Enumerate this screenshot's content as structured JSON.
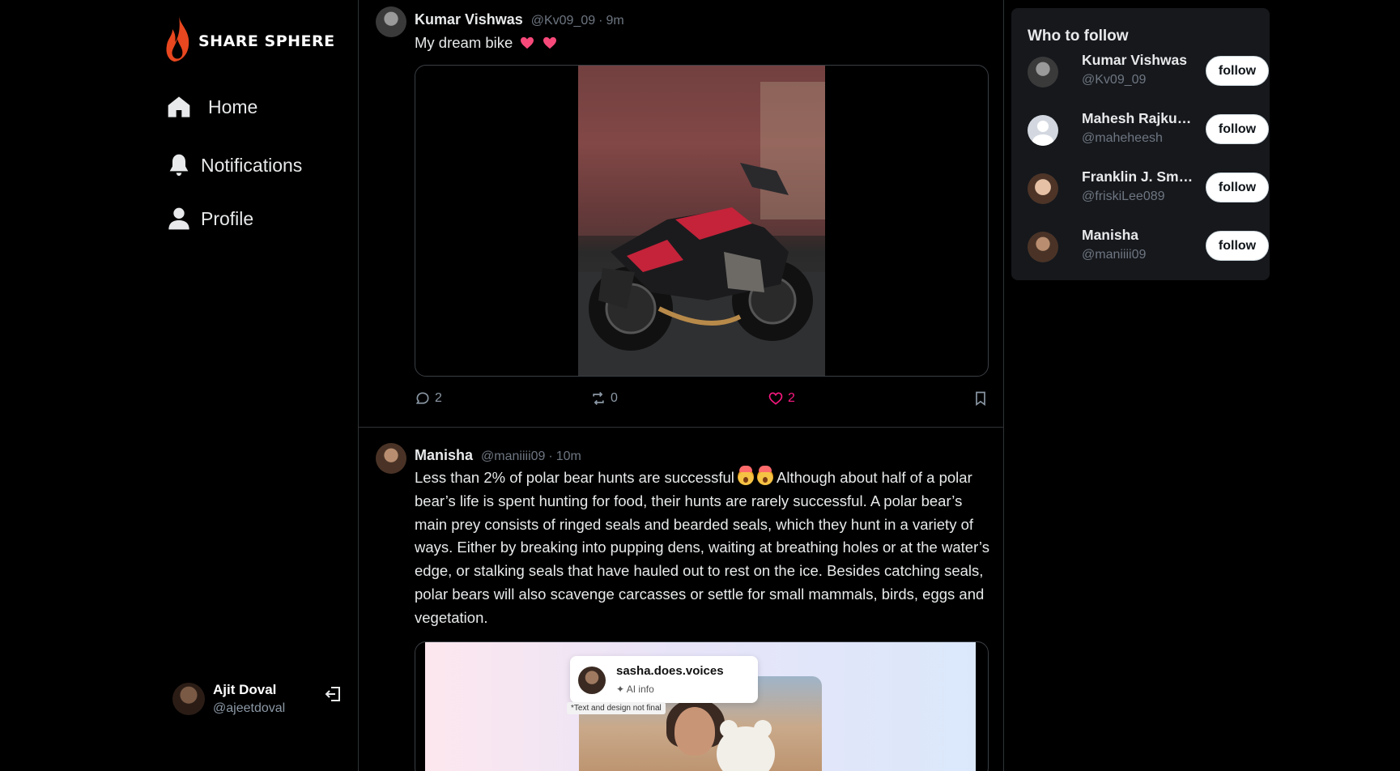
{
  "app": {
    "name": "SHARE SPHERE"
  },
  "nav": [
    {
      "label": "Home",
      "icon": "home-icon"
    },
    {
      "label": "Notifications",
      "icon": "bell-icon"
    },
    {
      "label": "Profile",
      "icon": "user-icon"
    }
  ],
  "current_user": {
    "name": "Ajit Doval",
    "handle": "@ajeetdoval"
  },
  "posts": [
    {
      "name": "Kumar Vishwas",
      "handle": "@Kv09_09",
      "separator": "·",
      "time": "9m",
      "text": "My dream bike",
      "emojis": [
        "heart",
        "heart"
      ],
      "replies": "2",
      "reposts": "0",
      "likes": "2",
      "liked": true
    },
    {
      "name": "Manisha",
      "handle": "@maniiii09",
      "separator": "·",
      "time": "10m",
      "text_head": "Less than 2% of polar bear hunts are successful",
      "text_tail": " Although about half of a polar bear’s life is spent hunting for food, their hunts are rarely successful. A polar bear’s main prey consists of ringed seals and bearded seals, which they hunt in a variety of ways. Either by breaking into pupping dens, waiting at breathing holes or at the water’s edge, or stalking seals that have hauled out to rest on the ice. Besides catching seals, polar bears will also scavenge carcasses or settle for small mammals, birds, eggs and vegetation.",
      "emojis": [
        "exploding-head",
        "exploding-head"
      ],
      "media": {
        "card_name": "sasha.does.voices",
        "card_sub": "✦ AI info",
        "note": "*Text and design not final"
      }
    }
  ],
  "who_to_follow": {
    "title": "Who to follow",
    "follow_label": "follow",
    "users": [
      {
        "name": "Kumar Vishwas",
        "handle": "@Kv09_09"
      },
      {
        "name": "Mahesh Rajkumar",
        "handle": "@maheheesh"
      },
      {
        "name": "Franklin J. Smith",
        "handle": "@friskiLee089"
      },
      {
        "name": "Manisha",
        "handle": "@maniiii09"
      }
    ]
  },
  "colors": {
    "background": "#000000",
    "panel": "#16181c",
    "like": "#f91880",
    "muted": "#6e7681",
    "logo_flame": "#e8471f"
  }
}
